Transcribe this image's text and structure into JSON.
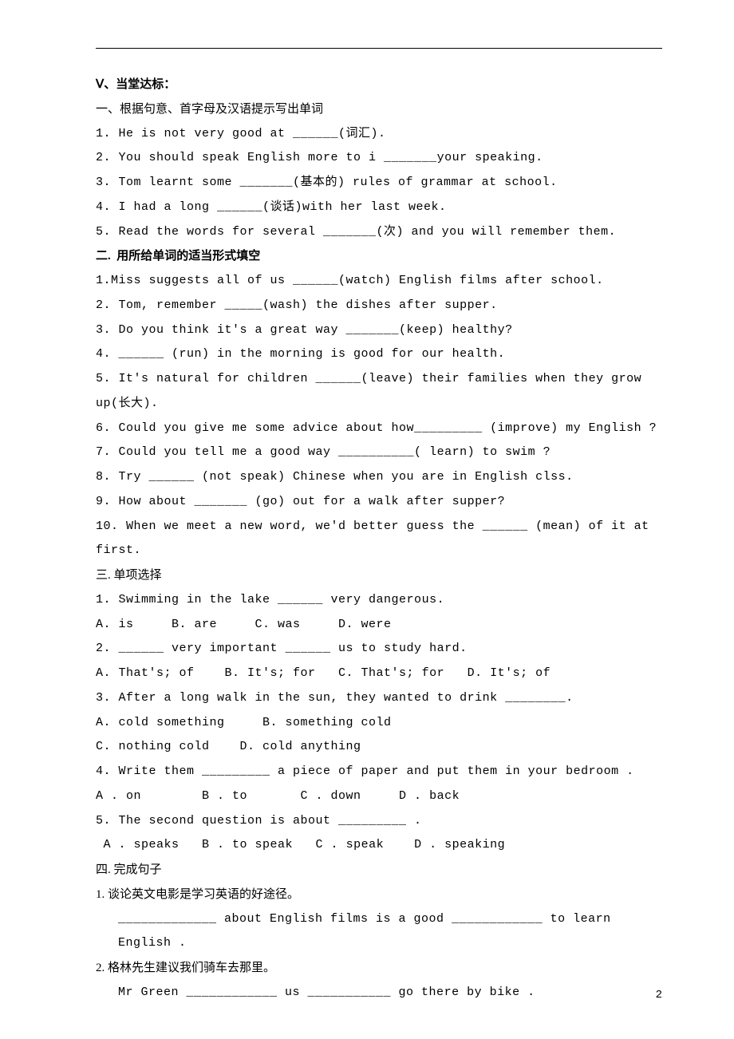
{
  "sec_v_heading": "Ⅴ、当堂达标：",
  "sec1": {
    "heading": "一、根据句意、首字母及汉语提示写出单词",
    "q1": "1. He is not very good at ______(词汇).",
    "q2": "2. You should speak English more to i _______your speaking.",
    "q3": "3. Tom learnt some _______(基本的) rules of grammar at school.",
    "q4": "4. I had a long ______(谈话)with her last week.",
    "q5": "5. Read the words for several _______(次) and you will remember them."
  },
  "sec2": {
    "heading": "二.  用所给单词的适当形式填空",
    "q1": "1.Miss suggests all of us ______(watch) English films after school.",
    "q2": "2. Tom, remember _____(wash) the dishes after supper.",
    "q3": "3. Do you think it's a great way _______(keep) healthy?",
    "q4": "4. ______ (run) in the morning is good for our health.",
    "q5": "5. It's natural for children ______(leave) their families when they grow up(长大).",
    "q6": "6. Could you give me some advice about how_________ (improve) my English ?",
    "q7": "7. Could you tell me a good way __________( learn) to swim ?",
    "q8": "8. Try ______ (not speak) Chinese when you are in English clss.",
    "q9": "9. How about _______ (go) out for a walk after supper?",
    "q10": "10. When we meet a new word, we'd better guess the ______ (mean) of it at first."
  },
  "sec3": {
    "heading": "三. 单项选择",
    "q1": "1. Swimming in the lake ______ very dangerous.",
    "q1o": "A. is     B. are     C. was     D. were",
    "q2": "2. ______ very important ______ us to study hard.",
    "q2o": "A. That's; of    B. It's; for   C. That's; for   D. It's; of",
    "q3": "3. After a long walk in the sun, they wanted to drink ________.",
    "q3o1": "A. cold something     B. something cold",
    "q3o2": "C. nothing cold    D. cold anything",
    "q4": "4. Write them _________ a piece of paper and put them in your bedroom .",
    "q4o": "A . on        B . to       C . down     D . back",
    "q5": "5. The second question is about _________ .",
    "q5o": " A . speaks   B . to speak   C . speak    D . speaking"
  },
  "sec4": {
    "heading": "四. 完成句子",
    "q1": "1. 谈论英文电影是学习英语的好途径。",
    "q1a": "_____________ about English films is a good ____________ to learn English .",
    "q2": "2. 格林先生建议我们骑车去那里。",
    "q2a": "Mr Green ____________ us ___________ go there by bike ."
  },
  "page_number": "2"
}
